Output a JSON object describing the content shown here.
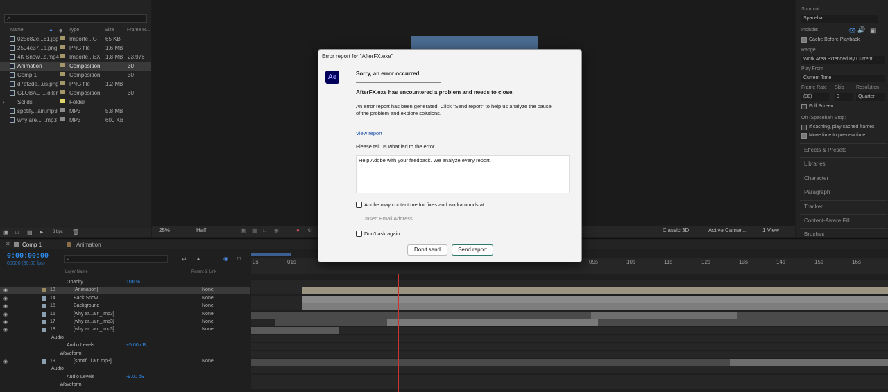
{
  "project": {
    "search_placeholder": "⌕",
    "columns": [
      "Name",
      "Type",
      "Size",
      "Frame R..."
    ],
    "items": [
      {
        "name": "025e82e...61.jpg",
        "type": "Importe...G",
        "size": "65 KB",
        "fr": "",
        "tag": "#a69768",
        "kind": "image"
      },
      {
        "name": "2594e37...s.png",
        "type": "PNG file",
        "size": "1.6 MB",
        "fr": "",
        "tag": "#a69768",
        "kind": "image"
      },
      {
        "name": "4K Snow...s.mp4",
        "type": "Importe...EX",
        "size": "1.8 MB",
        "fr": "23.976",
        "tag": "#a69768",
        "kind": "video"
      },
      {
        "name": "Animation",
        "type": "Composition",
        "size": "",
        "fr": "30",
        "tag": "#a69768",
        "kind": "comp"
      },
      {
        "name": "Comp 1",
        "type": "Composition",
        "size": "",
        "fr": "30",
        "tag": "#a69768",
        "kind": "comp"
      },
      {
        "name": "d7bf3de...us.png",
        "type": "PNG file",
        "size": "1.2 MB",
        "fr": "",
        "tag": "#a69768",
        "kind": "image"
      },
      {
        "name": "GLOBAL_...oller",
        "type": "Composition",
        "size": "",
        "fr": "30",
        "tag": "#a69768",
        "kind": "comp"
      },
      {
        "name": "Solids",
        "type": "Folder",
        "size": "",
        "fr": "",
        "tag": "#e0d46a",
        "kind": "folder"
      },
      {
        "name": "spotify...ain.mp3",
        "type": "MP3",
        "size": "5.8 MB",
        "fr": "",
        "tag": "#8c8c8c",
        "kind": "audio"
      },
      {
        "name": "why are..._.mp3",
        "type": "MP3",
        "size": "600 KB",
        "fr": "",
        "tag": "#8c8c8c",
        "kind": "audio"
      }
    ],
    "bpc": "8 bpc"
  },
  "viewer": {
    "zoom": "25%",
    "resolution": "Half",
    "renderer": "Classic 3D",
    "camera": "Active Camer...",
    "views": "1 View"
  },
  "preview": {
    "shortcut_label": "Shortcut",
    "shortcut_value": "Spacebar",
    "include_label": "Include:",
    "cache_label": "Cache Before Playback",
    "range_label": "Range",
    "range_value": "Work Area Extended By Current...",
    "playfrom_label": "Play From",
    "playfrom_value": "Current Time",
    "framerate_label": "Frame Rate",
    "skip_label": "Skip",
    "resolution_label": "Resolution",
    "framerate_value": "(30)",
    "skip_value": "0",
    "resolution_value": "Quarter",
    "fullscreen_label": "Full Screen",
    "onstop_label": "On (Spacebar) Stop:",
    "ifcaching_label": "If caching, play cached frames",
    "movetime_label": "Move time to preview time",
    "sections": [
      "Effects & Presets",
      "Libraries",
      "Character",
      "Paragraph",
      "Tracker",
      "Content-Aware Fill",
      "Brushes"
    ]
  },
  "timeline": {
    "tabs": [
      "Comp 1",
      "Animation"
    ],
    "current_time": "0:00:00:00",
    "fps": "00000 (30.00 fps)",
    "col_layer_name": "Layer Name",
    "col_parent": "Parent & Link",
    "ticks": [
      "0s",
      "01s",
      "09s",
      "10s",
      "11s",
      "12s",
      "13s",
      "14s",
      "15s",
      "16s"
    ],
    "layers": [
      {
        "id": "opacity",
        "num": "",
        "name": "Opacity",
        "value": "100 %",
        "parent": "",
        "prop": true
      },
      {
        "id": "l13",
        "num": "13",
        "name": "[Animation]",
        "value": "",
        "parent": "None",
        "prop": false,
        "selected": true
      },
      {
        "id": "l14",
        "num": "14",
        "name": "Back Snow",
        "value": "",
        "parent": "None",
        "prop": false
      },
      {
        "id": "l15",
        "num": "15",
        "name": "Background",
        "value": "",
        "parent": "None",
        "prop": false
      },
      {
        "id": "l16",
        "num": "16",
        "name": "[why ar...ain_.mp3]",
        "value": "",
        "parent": "None",
        "prop": false
      },
      {
        "id": "l17",
        "num": "17",
        "name": "[why ar...ain_.mp3]",
        "value": "",
        "parent": "None",
        "prop": false
      },
      {
        "id": "l18",
        "num": "18",
        "name": "[why ar...ain_.mp3]",
        "value": "",
        "parent": "None",
        "prop": false
      },
      {
        "id": "audio1",
        "num": "",
        "name": "Audio",
        "value": "",
        "parent": "",
        "prop": true
      },
      {
        "id": "levels1",
        "num": "",
        "name": "Audio Levels",
        "value": "+5.00 dB",
        "parent": "",
        "prop": true
      },
      {
        "id": "wave1",
        "num": "",
        "name": "Waveform",
        "value": "",
        "parent": "",
        "prop": true
      },
      {
        "id": "l19",
        "num": "19",
        "name": "[spotif...l.ain.mp3]",
        "value": "",
        "parent": "None",
        "prop": false
      },
      {
        "id": "audio2",
        "num": "",
        "name": "Audio",
        "value": "",
        "parent": "",
        "prop": true
      },
      {
        "id": "levels2",
        "num": "",
        "name": "Audio Levels",
        "value": "-9.00 dB",
        "parent": "",
        "prop": true
      },
      {
        "id": "wave2",
        "num": "",
        "name": "Waveform",
        "value": "",
        "parent": "",
        "prop": true
      }
    ]
  },
  "dialog": {
    "title": "Error report for \"AfterFX.exe\"",
    "logo": "Ae",
    "heading": "Sorry, an error occurred",
    "subheading": "AfterFX.exe has encountered a problem and needs to close.",
    "body_line1": "An error report has been generated. Click \"Send report\" to help us analyze the cause",
    "body_line2": "of the problem and explore solutions.",
    "view_report": "View report",
    "prompt": "Please tell us what led to the error.",
    "feedback_placeholder": "Help Adobe with your feedback. We analyze every report.",
    "contact_label": "Adobe may contact me for fixes and workarounds at",
    "email_placeholder": "Insert Email Address",
    "dont_ask_label": "Don't ask again.",
    "dont_send": "Don't send",
    "send_report": "Send report"
  },
  "colors": {
    "accent_blue": "#2d8ceb",
    "playhead": "#cc3333",
    "ae_logo_bg": "#00005b"
  }
}
